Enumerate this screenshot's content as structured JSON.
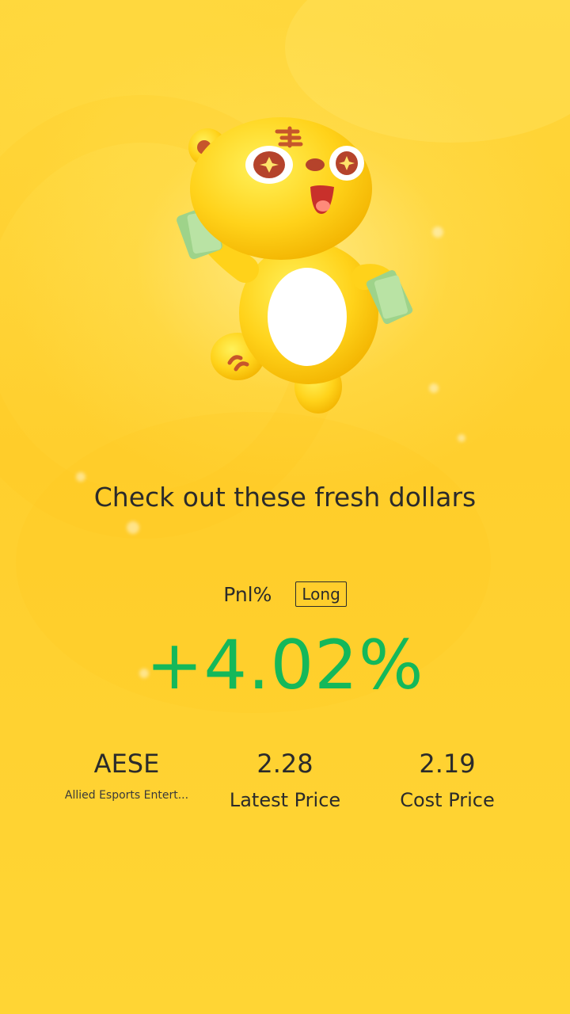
{
  "share_card": {
    "headline": "Check out these fresh dollars",
    "pnl_label": "Pnl%",
    "position_type": "Long",
    "pnl_value": "+4.02%",
    "pnl_color": "#14B85A",
    "mascot_icon": "tiger-mascot-icon"
  },
  "stats": {
    "ticker": "AESE",
    "company_name": "Allied Esports Entert...",
    "latest_price": "2.28",
    "latest_price_label": "Latest Price",
    "cost_price": "2.19",
    "cost_price_label": "Cost Price"
  }
}
